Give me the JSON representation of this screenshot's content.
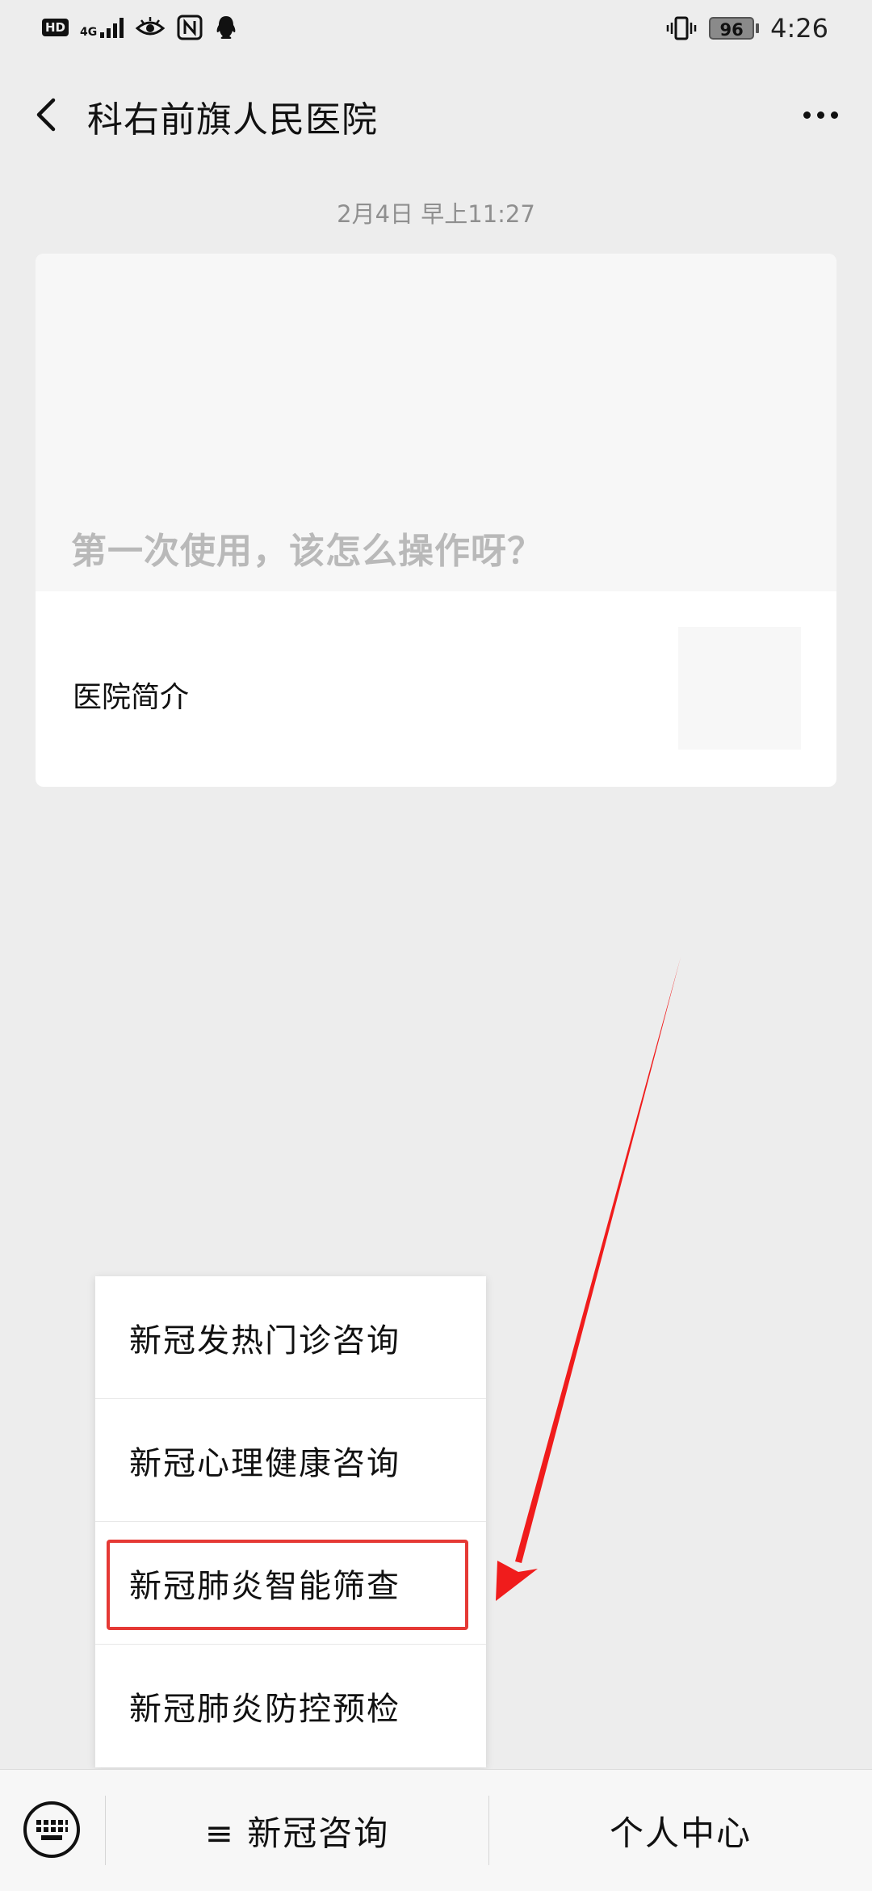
{
  "status_bar": {
    "hd_label": "HD",
    "network_label": "4G",
    "time": "4:26",
    "battery_percent": "96",
    "icons": [
      "hd-icon",
      "signal-icon",
      "eye-icon",
      "nfc-icon",
      "qq-icon",
      "vibrate-icon",
      "battery-icon"
    ]
  },
  "header": {
    "title": "科右前旗人民医院",
    "back_icon": "chevron-left-icon",
    "more_icon": "more-dots-icon"
  },
  "chat": {
    "timestamp": "2月4日 早上11:27",
    "article": {
      "cover_title": "第一次使用，该怎么操作呀？",
      "sub_title": "医院简介"
    }
  },
  "popup_menu": {
    "items": [
      {
        "label": "新冠发热门诊咨询"
      },
      {
        "label": "新冠心理健康咨询"
      },
      {
        "label": "新冠肺炎智能筛查",
        "highlighted": true
      },
      {
        "label": "新冠肺炎防控预检"
      }
    ],
    "highlight_color": "#e53935"
  },
  "bottom_menu": {
    "keyboard_icon": "keyboard-icon",
    "menu1_label": "≡ 新冠咨询",
    "menu2_label": "个人中心"
  },
  "annotation": {
    "arrow_color": "#f01c1c"
  }
}
